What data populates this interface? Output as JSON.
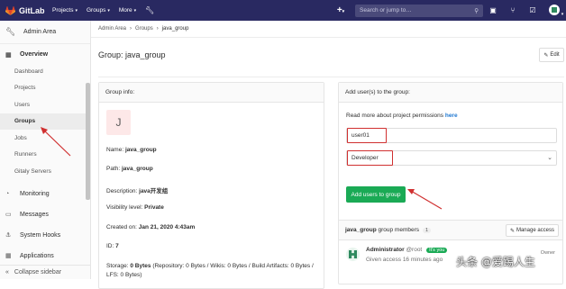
{
  "topbar": {
    "brand": "GitLab",
    "nav": [
      "Projects",
      "Groups",
      "More"
    ],
    "search_placeholder": "Search or jump to…"
  },
  "sidebar": {
    "title": "Admin Area",
    "overview": "Overview",
    "subitems": [
      "Dashboard",
      "Projects",
      "Users",
      "Groups",
      "Jobs",
      "Runners",
      "Gitaly Servers"
    ],
    "items": [
      "Monitoring",
      "Messages",
      "System Hooks",
      "Applications"
    ],
    "collapse": "Collapse sidebar"
  },
  "breadcrumb": [
    "Admin Area",
    "Groups",
    "java_group"
  ],
  "page": {
    "title": "Group: java_group",
    "edit": "Edit"
  },
  "group_info": {
    "header": "Group info:",
    "avatar_letter": "J",
    "name_label": "Name:",
    "name": "java_group",
    "path_label": "Path:",
    "path": "java_group",
    "desc_label": "Description:",
    "desc": "java开发组",
    "vis_label": "Visibility level:",
    "vis": "Private",
    "created_label": "Created on:",
    "created": "Jan 21, 2020 4:43am",
    "id_label": "ID:",
    "id": "7",
    "storage_label": "Storage:",
    "storage": "0 Bytes",
    "storage_detail": "(Repository: 0 Bytes / Wikis: 0 Bytes / Build Artifacts: 0 Bytes /",
    "storage_detail2": "LFS: 0 Bytes)"
  },
  "add_users": {
    "header": "Add user(s) to the group:",
    "permissions_text": "Read more about project permissions",
    "permissions_link": "here",
    "user_value": "user01",
    "role_value": "Developer",
    "button": "Add users to group"
  },
  "members": {
    "group": "java_group",
    "suffix": "group members",
    "count": "1",
    "manage": "Manage access",
    "name": "Administrator",
    "handle": "@root",
    "you": "It's you",
    "given": "Given access 16 minutes ago",
    "role": "Owner"
  },
  "watermark": "头条 @爱踢人生"
}
